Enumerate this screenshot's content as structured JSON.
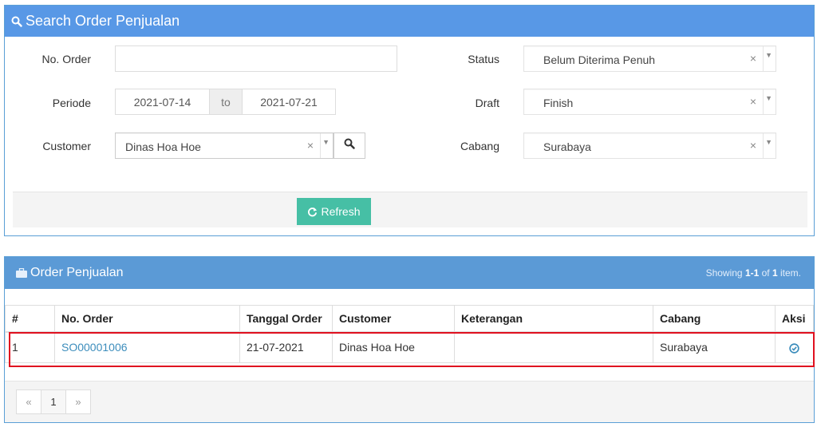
{
  "search": {
    "title": "Search Order Penjualan",
    "no_order_label": "No. Order",
    "no_order_value": "",
    "periode_label": "Periode",
    "date_from": "2021-07-14",
    "to_label": "to",
    "date_to": "2021-07-21",
    "customer_label": "Customer",
    "customer_value": "Dinas Hoa Hoe",
    "status_label": "Status",
    "status_value": "Belum Diterima Penuh",
    "draft_label": "Draft",
    "draft_value": "Finish",
    "cabang_label": "Cabang",
    "cabang_value": "Surabaya",
    "clear_glyph": "×",
    "arrow_glyph": "▼",
    "refresh_label": "Refresh"
  },
  "orders": {
    "title": "Order Penjualan",
    "showing_prefix": "Showing ",
    "showing_range": "1-1",
    "showing_of": " of ",
    "showing_total": "1",
    "showing_suffix": " item.",
    "columns": [
      "#",
      "No. Order",
      "Tanggal Order",
      "Customer",
      "Keterangan",
      "Cabang",
      "Aksi"
    ],
    "rows": [
      {
        "num": "1",
        "no_order": "SO00001006",
        "tanggal": "21-07-2021",
        "customer": "Dinas Hoa Hoe",
        "keterangan": "",
        "cabang": "Surabaya"
      }
    ],
    "pager": {
      "prev": "«",
      "page": "1",
      "next": "»"
    }
  },
  "colors": {
    "header_blue": "#5898e6",
    "refresh_green": "#46bfa5",
    "highlight_red": "#e0101f",
    "link_blue": "#3c8dbc"
  },
  "icons": [
    "search-icon",
    "briefcase-icon",
    "refresh-icon",
    "check-circle-icon"
  ]
}
